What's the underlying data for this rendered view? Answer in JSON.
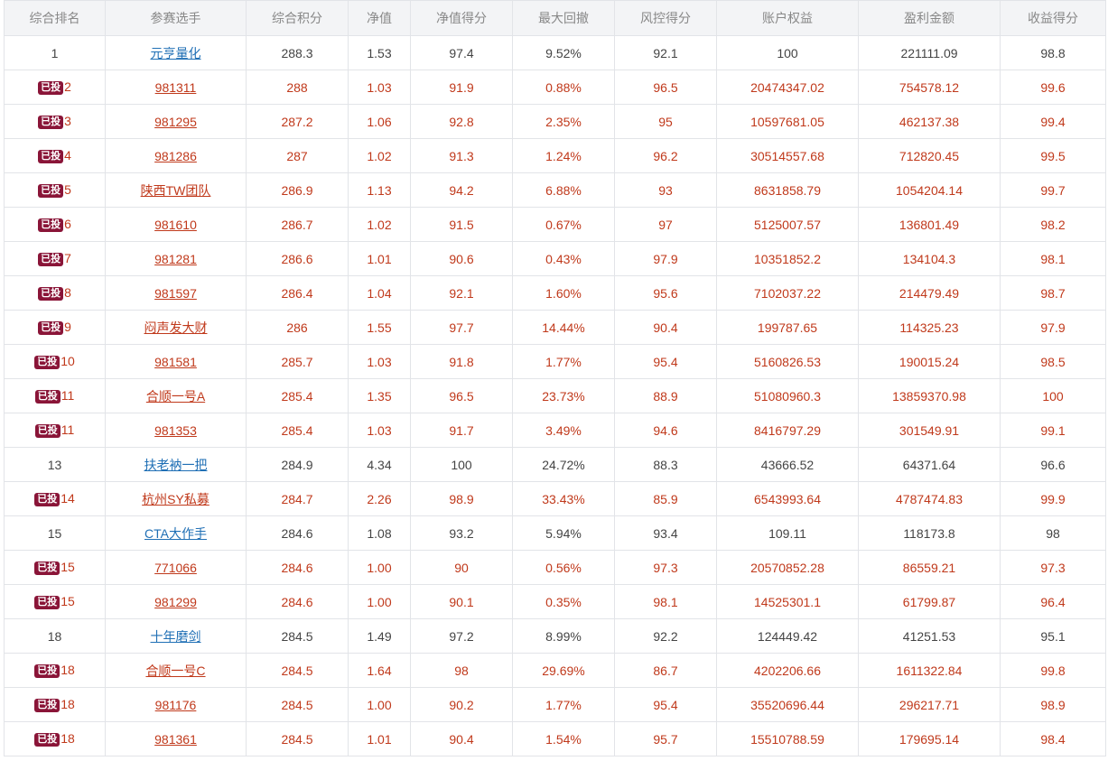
{
  "columns": [
    "综合排名",
    "参赛选手",
    "综合积分",
    "净值",
    "净值得分",
    "最大回撤",
    "风控得分",
    "账户权益",
    "盈利金额",
    "收益得分"
  ],
  "badge_label": "已投",
  "colors": {
    "invested_text": "#c0391b",
    "normal_text": "#444444",
    "link_blue": "#1f6fb5",
    "badge_bg": "#8a1538"
  },
  "rows": [
    {
      "rank": "1",
      "invested": false,
      "name": "元亨量化",
      "score": "288.3",
      "nav": "1.53",
      "nav_score": "97.4",
      "max_dd": "9.52%",
      "risk_score": "92.1",
      "equity": "100",
      "profit": "221111.09",
      "return_score": "98.8"
    },
    {
      "rank": "2",
      "invested": true,
      "name": "981311",
      "score": "288",
      "nav": "1.03",
      "nav_score": "91.9",
      "max_dd": "0.88%",
      "risk_score": "96.5",
      "equity": "20474347.02",
      "profit": "754578.12",
      "return_score": "99.6"
    },
    {
      "rank": "3",
      "invested": true,
      "name": "981295",
      "score": "287.2",
      "nav": "1.06",
      "nav_score": "92.8",
      "max_dd": "2.35%",
      "risk_score": "95",
      "equity": "10597681.05",
      "profit": "462137.38",
      "return_score": "99.4"
    },
    {
      "rank": "4",
      "invested": true,
      "name": "981286",
      "score": "287",
      "nav": "1.02",
      "nav_score": "91.3",
      "max_dd": "1.24%",
      "risk_score": "96.2",
      "equity": "30514557.68",
      "profit": "712820.45",
      "return_score": "99.5"
    },
    {
      "rank": "5",
      "invested": true,
      "name": "陕西TW团队",
      "score": "286.9",
      "nav": "1.13",
      "nav_score": "94.2",
      "max_dd": "6.88%",
      "risk_score": "93",
      "equity": "8631858.79",
      "profit": "1054204.14",
      "return_score": "99.7"
    },
    {
      "rank": "6",
      "invested": true,
      "name": "981610",
      "score": "286.7",
      "nav": "1.02",
      "nav_score": "91.5",
      "max_dd": "0.67%",
      "risk_score": "97",
      "equity": "5125007.57",
      "profit": "136801.49",
      "return_score": "98.2"
    },
    {
      "rank": "7",
      "invested": true,
      "name": "981281",
      "score": "286.6",
      "nav": "1.01",
      "nav_score": "90.6",
      "max_dd": "0.43%",
      "risk_score": "97.9",
      "equity": "10351852.2",
      "profit": "134104.3",
      "return_score": "98.1"
    },
    {
      "rank": "8",
      "invested": true,
      "name": "981597",
      "score": "286.4",
      "nav": "1.04",
      "nav_score": "92.1",
      "max_dd": "1.60%",
      "risk_score": "95.6",
      "equity": "7102037.22",
      "profit": "214479.49",
      "return_score": "98.7"
    },
    {
      "rank": "9",
      "invested": true,
      "name": "闷声发大财",
      "score": "286",
      "nav": "1.55",
      "nav_score": "97.7",
      "max_dd": "14.44%",
      "risk_score": "90.4",
      "equity": "199787.65",
      "profit": "114325.23",
      "return_score": "97.9"
    },
    {
      "rank": "10",
      "invested": true,
      "name": "981581",
      "score": "285.7",
      "nav": "1.03",
      "nav_score": "91.8",
      "max_dd": "1.77%",
      "risk_score": "95.4",
      "equity": "5160826.53",
      "profit": "190015.24",
      "return_score": "98.5"
    },
    {
      "rank": "11",
      "invested": true,
      "name": "合顺一号A",
      "score": "285.4",
      "nav": "1.35",
      "nav_score": "96.5",
      "max_dd": "23.73%",
      "risk_score": "88.9",
      "equity": "51080960.3",
      "profit": "13859370.98",
      "return_score": "100"
    },
    {
      "rank": "11",
      "invested": true,
      "name": "981353",
      "score": "285.4",
      "nav": "1.03",
      "nav_score": "91.7",
      "max_dd": "3.49%",
      "risk_score": "94.6",
      "equity": "8416797.29",
      "profit": "301549.91",
      "return_score": "99.1"
    },
    {
      "rank": "13",
      "invested": false,
      "name": "扶老衲一把",
      "score": "284.9",
      "nav": "4.34",
      "nav_score": "100",
      "max_dd": "24.72%",
      "risk_score": "88.3",
      "equity": "43666.52",
      "profit": "64371.64",
      "return_score": "96.6"
    },
    {
      "rank": "14",
      "invested": true,
      "name": "杭州SY私募",
      "score": "284.7",
      "nav": "2.26",
      "nav_score": "98.9",
      "max_dd": "33.43%",
      "risk_score": "85.9",
      "equity": "6543993.64",
      "profit": "4787474.83",
      "return_score": "99.9"
    },
    {
      "rank": "15",
      "invested": false,
      "name": "CTA大作手",
      "score": "284.6",
      "nav": "1.08",
      "nav_score": "93.2",
      "max_dd": "5.94%",
      "risk_score": "93.4",
      "equity": "109.11",
      "profit": "118173.8",
      "return_score": "98"
    },
    {
      "rank": "15",
      "invested": true,
      "name": "771066",
      "score": "284.6",
      "nav": "1.00",
      "nav_score": "90",
      "max_dd": "0.56%",
      "risk_score": "97.3",
      "equity": "20570852.28",
      "profit": "86559.21",
      "return_score": "97.3"
    },
    {
      "rank": "15",
      "invested": true,
      "name": "981299",
      "score": "284.6",
      "nav": "1.00",
      "nav_score": "90.1",
      "max_dd": "0.35%",
      "risk_score": "98.1",
      "equity": "14525301.1",
      "profit": "61799.87",
      "return_score": "96.4"
    },
    {
      "rank": "18",
      "invested": false,
      "name": "十年磨剑",
      "score": "284.5",
      "nav": "1.49",
      "nav_score": "97.2",
      "max_dd": "8.99%",
      "risk_score": "92.2",
      "equity": "124449.42",
      "profit": "41251.53",
      "return_score": "95.1"
    },
    {
      "rank": "18",
      "invested": true,
      "name": "合顺一号C",
      "score": "284.5",
      "nav": "1.64",
      "nav_score": "98",
      "max_dd": "29.69%",
      "risk_score": "86.7",
      "equity": "4202206.66",
      "profit": "1611322.84",
      "return_score": "99.8"
    },
    {
      "rank": "18",
      "invested": true,
      "name": "981176",
      "score": "284.5",
      "nav": "1.00",
      "nav_score": "90.2",
      "max_dd": "1.77%",
      "risk_score": "95.4",
      "equity": "35520696.44",
      "profit": "296217.71",
      "return_score": "98.9"
    },
    {
      "rank": "18",
      "invested": true,
      "name": "981361",
      "score": "284.5",
      "nav": "1.01",
      "nav_score": "90.4",
      "max_dd": "1.54%",
      "risk_score": "95.7",
      "equity": "15510788.59",
      "profit": "179695.14",
      "return_score": "98.4"
    }
  ]
}
